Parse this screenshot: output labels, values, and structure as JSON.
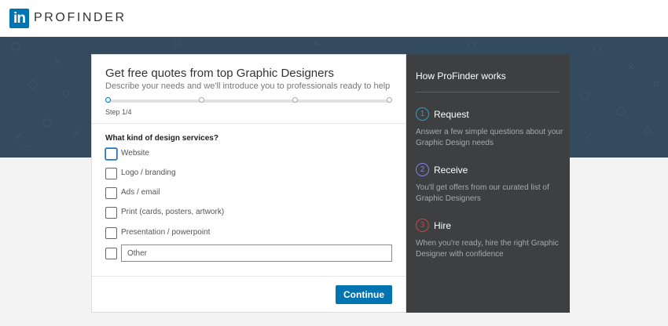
{
  "header": {
    "logo_text": "in",
    "brand": "PROFINDER"
  },
  "form": {
    "title": "Get free quotes from top Graphic Designers",
    "subtitle": "Describe your needs and we'll introduce you to professionals ready to help",
    "progress": {
      "current_step": 1,
      "total_steps": 4
    },
    "step_label": "Step 1/4",
    "question": "What kind of design services?",
    "options": [
      {
        "label": "Website",
        "checked": false
      },
      {
        "label": "Logo / branding",
        "checked": false
      },
      {
        "label": "Ads / email",
        "checked": false
      },
      {
        "label": "Print (cards, posters, artwork)",
        "checked": false
      },
      {
        "label": "Presentation / powerpoint",
        "checked": false
      }
    ],
    "other": {
      "placeholder": "Other",
      "value": "",
      "checked": false
    },
    "continue_label": "Continue"
  },
  "sidebar": {
    "title": "How ProFinder works",
    "steps": [
      {
        "number": "1",
        "name": "Request",
        "description": "Answer a few simple questions about your Graphic Design needs"
      },
      {
        "number": "2",
        "name": "Receive",
        "description": "You'll get offers from our curated list of Graphic Designers"
      },
      {
        "number": "3",
        "name": "Hire",
        "description": "When you're ready, hire the right Graphic Designer with confidence"
      }
    ]
  },
  "colors": {
    "brand_blue": "#0073b1",
    "banner": "#344a5e",
    "sidebar_bg": "#3d3f41",
    "step1": "#21a1d6",
    "step2": "#8a7fe0",
    "step3": "#e0393e"
  }
}
